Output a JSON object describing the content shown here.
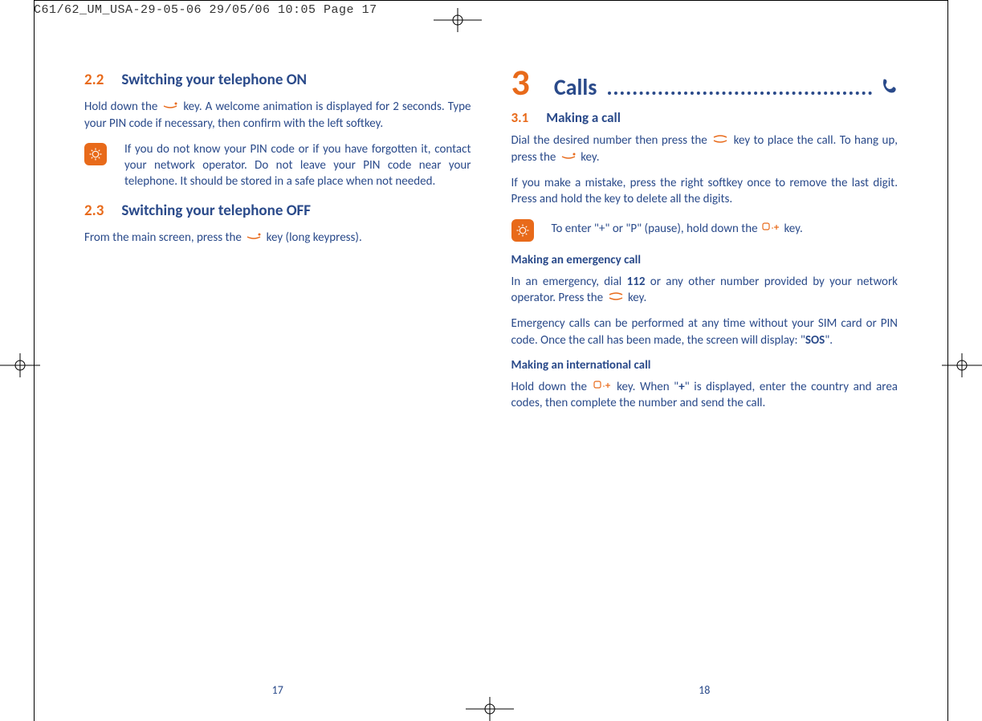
{
  "header": "C61/62_UM_USA-29-05-06  29/05/06  10:05  Page 17",
  "left": {
    "s22": {
      "num": "2.2",
      "title": "Switching your telephone ON"
    },
    "p22a": "Hold down the",
    "p22b": "key. A welcome animation is displayed for 2 seconds. Type your PIN code if necessary, then confirm with the left softkey.",
    "note22": "If you do not know your PIN code or if you have forgotten it, contact your network operator. Do not leave your PIN code near your telephone. It should be stored in a safe place when not needed.",
    "s23": {
      "num": "2.3",
      "title": "Switching your telephone OFF"
    },
    "p23a": "From the main screen, press the",
    "p23b": "key (long keypress).",
    "pagenum": "17"
  },
  "right": {
    "chapter": {
      "num": "3",
      "title": "Calls"
    },
    "s31": {
      "num": "3.1",
      "title": "Making a call"
    },
    "p31a": "Dial the desired number then press the",
    "p31b": "key to place the call. To hang up, press the",
    "p31c": "key.",
    "p32": "If you make a mistake, press the right softkey once to remove the last digit. Press and hold the key to delete all the digits.",
    "note31a": "To enter \"+\" or \"P\" (pause), hold down the",
    "note31b": "key.",
    "sub_emergency": "Making an emergency call",
    "p_em1a": "In an emergency, dial",
    "p_em1_num": "112",
    "p_em1b": "or any other number provided by your network operator. Press the",
    "p_em1c": "key.",
    "p_em2a": "Emergency calls can be performed at any time without your SIM card or PIN code. Once the call has been made, the screen will display: \"",
    "p_em2_sos": "SOS",
    "p_em2b": "\".",
    "sub_intl": "Making an international call",
    "p_intl1a": "Hold down the",
    "p_intl1b": "key. When \"",
    "p_intl1_plus": "+",
    "p_intl1c": "\" is displayed, enter the country and area codes, then complete the number and send the call.",
    "pagenum": "18"
  }
}
